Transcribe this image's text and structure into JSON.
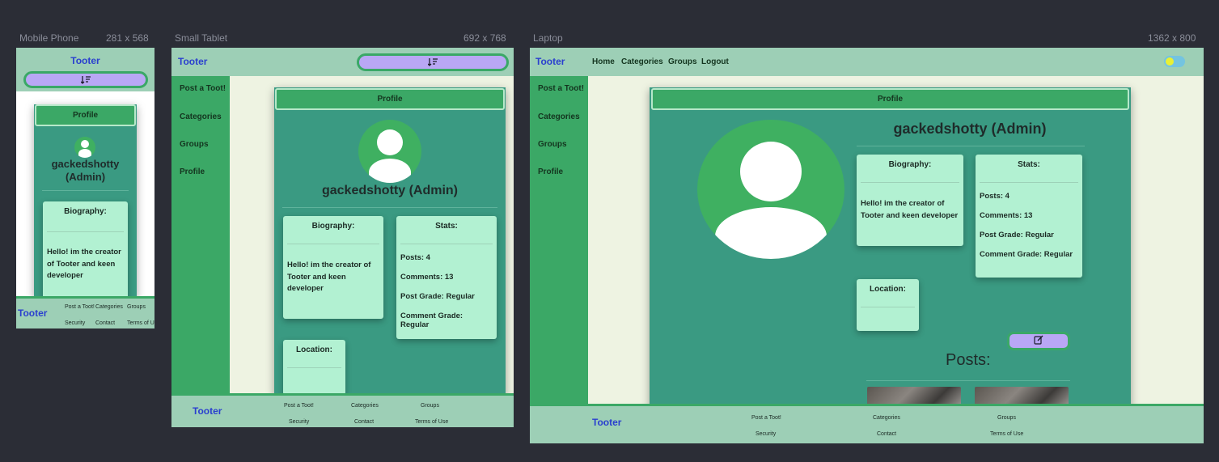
{
  "devices": {
    "mobile": {
      "name": "Mobile Phone",
      "size": "281 x 568"
    },
    "tablet": {
      "name": "Small Tablet",
      "size": "692 x 768"
    },
    "laptop": {
      "name": "Laptop",
      "size": "1362 x 800"
    }
  },
  "app": {
    "brand": "Tooter",
    "nav_links": [
      "Home",
      "Categories",
      "Groups",
      "Logout"
    ],
    "sidebar": [
      "Post a Toot!",
      "Categories",
      "Groups",
      "Profile"
    ],
    "profile_header": "Profile",
    "username": "gackedshotty (Admin)",
    "username_mobile_line1": "gackedshotty",
    "username_mobile_line2": "(Admin)",
    "biography_title": "Biography:",
    "biography_text": "Hello! im the creator of Tooter and keen developer",
    "stats_title": "Stats:",
    "stats": [
      "Posts: 4",
      "Comments: 13",
      "Post Grade: Regular",
      "Comment Grade: Regular"
    ],
    "location_title": "Location:",
    "posts_title": "Posts:",
    "footer_links": [
      "Post a Toot!",
      "Categories",
      "Groups",
      "Security",
      "Contact",
      "Terms of Use"
    ],
    "icons": {
      "sort": "sort-icon",
      "edit": "edit-icon",
      "avatar": "user-avatar-icon",
      "theme_toggle": "theme-toggle"
    }
  },
  "colors": {
    "navbar": "#9dcfb6",
    "sidebar": "#3ba866",
    "card": "#3a9a82",
    "info_box": "#b2f1d2",
    "brand": "#2a3fcf",
    "button": "#b9a7f5"
  }
}
